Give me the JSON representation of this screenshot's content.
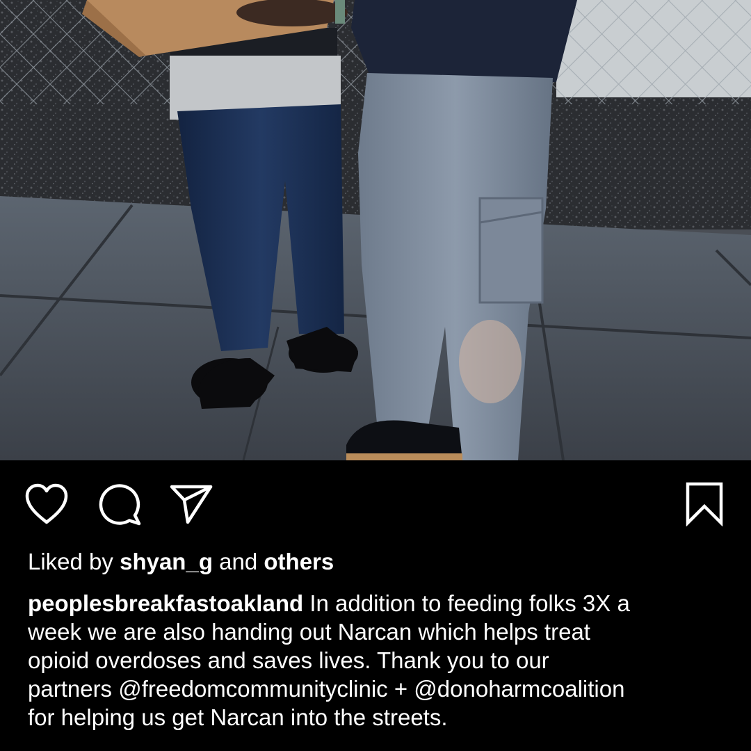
{
  "post": {
    "image_alt": "Two people standing on a sidewalk by a chain-link fence",
    "liked_by": {
      "prefix": "Liked by",
      "user": "shyan_g",
      "connector": "and",
      "others": "others"
    },
    "caption": {
      "username": "peoplesbreakfastoakland",
      "line1_text": " In addition to feeding folks 3X a",
      "line2": "week we are also handing out Narcan which helps treat",
      "line3": "opioid overdoses and saves lives. Thank you to our",
      "line4_prefix": "partners ",
      "mention1": "@freedomcommunityclinic",
      "line4_mid": " + ",
      "mention2": "@donoharmcoalition",
      "line5": "for helping us get Narcan into the streets."
    }
  },
  "icons": {
    "like": "heart-icon",
    "comment": "comment-bubble-icon",
    "share": "paper-plane-icon",
    "save": "bookmark-icon"
  },
  "colors": {
    "background": "#000000",
    "text": "#ffffff"
  }
}
